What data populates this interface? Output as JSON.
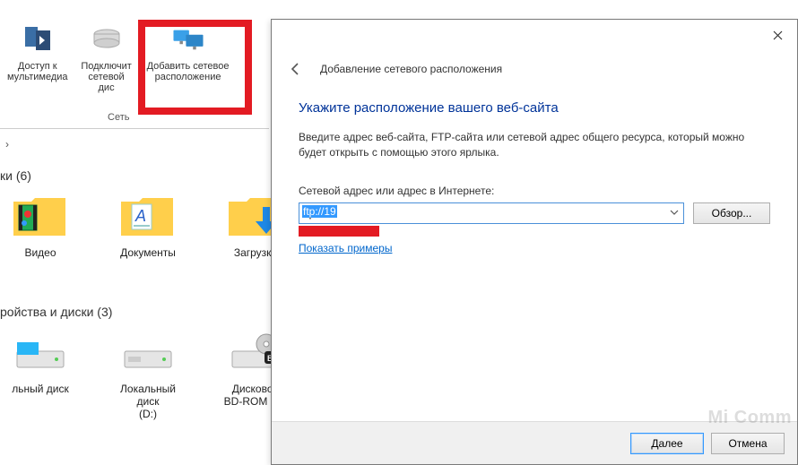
{
  "ribbon": {
    "section_label": "Сеть",
    "items": [
      {
        "label_l1": "Доступ к",
        "label_l2": "мультимедиа"
      },
      {
        "label_l1": "Подключит",
        "label_l2": "сетевой дис"
      },
      {
        "label_l1": "Добавить сетевое",
        "label_l2": "расположение"
      }
    ]
  },
  "explorer": {
    "section_folders": "ки (6)",
    "section_drives": "ройства и диски (3)",
    "folders": [
      {
        "label": "Видео"
      },
      {
        "label": "Документы"
      },
      {
        "label": "Загрузки"
      }
    ],
    "drives": [
      {
        "label_l1": "льный диск"
      },
      {
        "label_l1": "Локальный диск",
        "label_l2": "(D:)"
      },
      {
        "label_l1": "Дисковод",
        "label_l2": "BD-ROM (F:)"
      }
    ]
  },
  "wizard": {
    "window_title": "Добавление сетевого расположения",
    "heading": "Укажите расположение вашего веб-сайта",
    "description": "Введите адрес веб-сайта, FTP-сайта или сетевой адрес общего ресурса, который можно будет открыть с помощью этого ярлыка.",
    "address_label": "Сетевой адрес или адрес в Интернете:",
    "address_value": "ftp://19",
    "browse": "Обзор...",
    "examples_link": "Показать примеры",
    "next": "Далее",
    "cancel": "Отмена"
  },
  "watermark": "Mi Comm"
}
